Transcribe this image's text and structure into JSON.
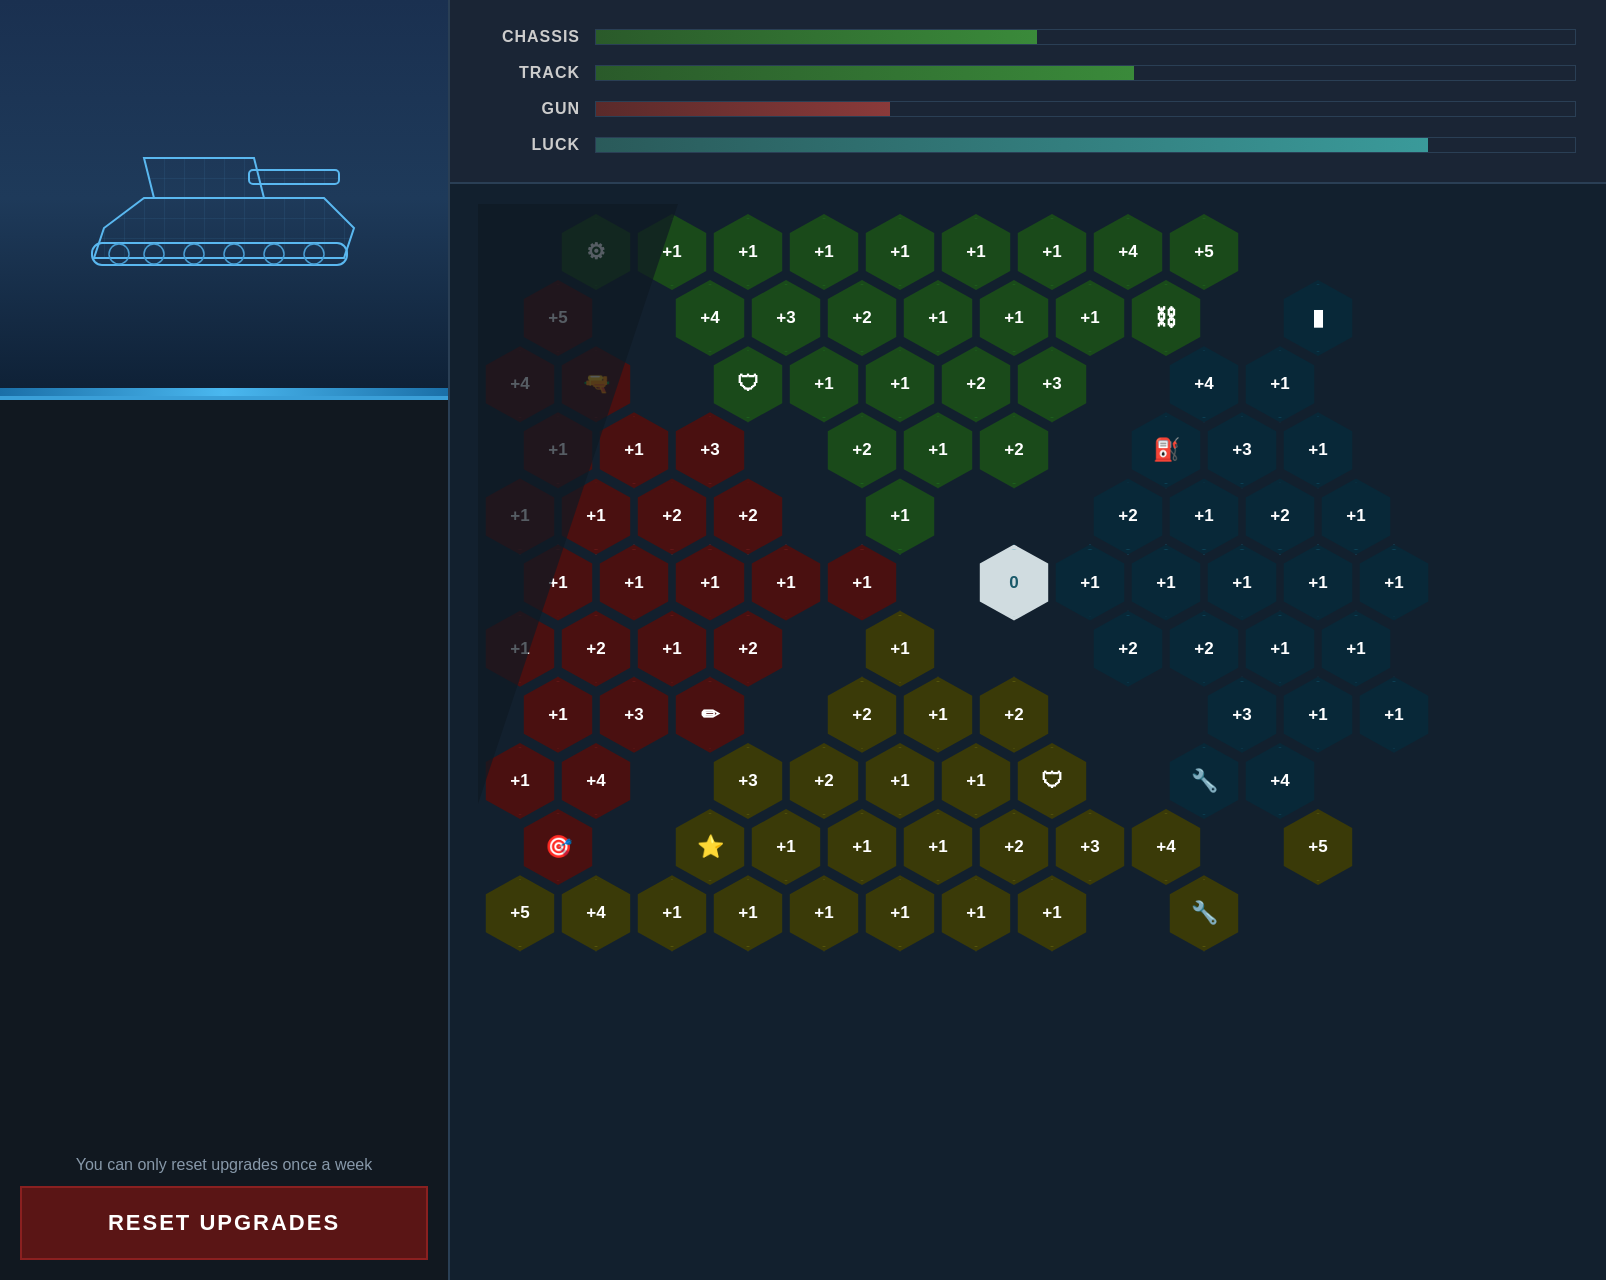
{
  "leftPanel": {
    "tankAlt": "Tank silhouette",
    "resetNotice": "You can only reset upgrades once a week",
    "resetButton": "RESET UPGRADES"
  },
  "stats": [
    {
      "label": "CHASSIS",
      "fillClass": "chassis-fill",
      "width": "45%"
    },
    {
      "label": "TRACK",
      "fillClass": "track-fill",
      "width": "55%"
    },
    {
      "label": "GUN",
      "fillClass": "gun-fill",
      "width": "30%"
    },
    {
      "label": "LUCK",
      "fillClass": "luck-fill",
      "width": "85%"
    }
  ],
  "colors": {
    "green": "#2a8a2a",
    "red": "#8a2a2a",
    "yellow": "#8a8a1a",
    "teal": "#1a6a8a",
    "center": "#3a8a9a"
  },
  "hexGrid": {
    "centerLabel": "0",
    "cells": [
      {
        "row": 0,
        "col": 0,
        "type": "green",
        "icon": "⚙",
        "label": ""
      },
      {
        "row": 0,
        "col": 1,
        "type": "green",
        "icon": "",
        "label": "+1"
      },
      {
        "row": 0,
        "col": 2,
        "type": "green",
        "icon": "",
        "label": "+1"
      },
      {
        "row": 0,
        "col": 3,
        "type": "green",
        "icon": "",
        "label": "+1"
      },
      {
        "row": 0,
        "col": 4,
        "type": "green",
        "icon": "",
        "label": "+1"
      },
      {
        "row": 0,
        "col": 5,
        "type": "green",
        "icon": "",
        "label": "+1"
      },
      {
        "row": 0,
        "col": 6,
        "type": "green",
        "icon": "",
        "label": "+1"
      },
      {
        "row": 0,
        "col": 7,
        "type": "green",
        "icon": "",
        "label": "+4"
      },
      {
        "row": 0,
        "col": 8,
        "type": "green",
        "icon": "",
        "label": "+5"
      },
      {
        "row": 1,
        "col": -1,
        "type": "red",
        "icon": "",
        "label": "+5"
      },
      {
        "row": 1,
        "col": 1,
        "type": "green",
        "icon": "",
        "label": "+4"
      },
      {
        "row": 1,
        "col": 2,
        "type": "green",
        "icon": "",
        "label": "+3"
      },
      {
        "row": 1,
        "col": 3,
        "type": "green",
        "icon": "",
        "label": "+2"
      },
      {
        "row": 1,
        "col": 4,
        "type": "green",
        "icon": "",
        "label": "+1"
      },
      {
        "row": 1,
        "col": 5,
        "type": "green",
        "icon": "",
        "label": "+1"
      },
      {
        "row": 1,
        "col": 6,
        "type": "green",
        "icon": "",
        "label": "+1"
      },
      {
        "row": 1,
        "col": 7,
        "type": "green",
        "icon": "⛓",
        "label": ""
      },
      {
        "row": 1,
        "col": 9,
        "type": "teal",
        "icon": "▮",
        "label": ""
      },
      {
        "row": 2,
        "col": -1,
        "type": "red",
        "icon": "",
        "label": "+4"
      },
      {
        "row": 2,
        "col": 0,
        "type": "red",
        "icon": "🔫",
        "label": ""
      },
      {
        "row": 2,
        "col": 2,
        "type": "green",
        "icon": "🛡",
        "label": ""
      },
      {
        "row": 2,
        "col": 3,
        "type": "green",
        "icon": "",
        "label": "+1"
      },
      {
        "row": 2,
        "col": 4,
        "type": "green",
        "icon": "",
        "label": "+1"
      },
      {
        "row": 2,
        "col": 5,
        "type": "green",
        "icon": "",
        "label": "+2"
      },
      {
        "row": 2,
        "col": 6,
        "type": "green",
        "icon": "",
        "label": "+3"
      },
      {
        "row": 2,
        "col": 8,
        "type": "teal",
        "icon": "",
        "label": "+4"
      },
      {
        "row": 2,
        "col": 9,
        "type": "teal",
        "icon": "",
        "label": "+1"
      },
      {
        "row": 3,
        "col": -1,
        "type": "red",
        "icon": "",
        "label": "+1"
      },
      {
        "row": 3,
        "col": 0,
        "type": "red",
        "icon": "",
        "label": "+1"
      },
      {
        "row": 3,
        "col": 1,
        "type": "red",
        "icon": "",
        "label": "+3"
      },
      {
        "row": 3,
        "col": 3,
        "type": "green",
        "icon": "",
        "label": "+2"
      },
      {
        "row": 3,
        "col": 4,
        "type": "green",
        "icon": "",
        "label": "+1"
      },
      {
        "row": 3,
        "col": 5,
        "type": "green",
        "icon": "",
        "label": "+2"
      },
      {
        "row": 3,
        "col": 7,
        "type": "teal",
        "icon": "⛽",
        "label": ""
      },
      {
        "row": 3,
        "col": 8,
        "type": "teal",
        "icon": "",
        "label": "+3"
      },
      {
        "row": 3,
        "col": 9,
        "type": "teal",
        "icon": "",
        "label": "+1"
      },
      {
        "row": 4,
        "col": -1,
        "type": "red",
        "icon": "",
        "label": "+1"
      },
      {
        "row": 4,
        "col": 0,
        "type": "red",
        "icon": "",
        "label": "+1"
      },
      {
        "row": 4,
        "col": 1,
        "type": "red",
        "icon": "",
        "label": "+2"
      },
      {
        "row": 4,
        "col": 2,
        "type": "red",
        "icon": "",
        "label": "+2"
      },
      {
        "row": 4,
        "col": 4,
        "type": "green",
        "icon": "",
        "label": "+1"
      },
      {
        "row": 4,
        "col": 7,
        "type": "teal",
        "icon": "",
        "label": "+2"
      },
      {
        "row": 4,
        "col": 8,
        "type": "teal",
        "icon": "",
        "label": "+1"
      },
      {
        "row": 4,
        "col": 9,
        "type": "teal",
        "icon": "",
        "label": "+2"
      },
      {
        "row": 4,
        "col": 10,
        "type": "teal",
        "icon": "",
        "label": "+1"
      },
      {
        "row": 5,
        "col": -1,
        "type": "red",
        "icon": "",
        "label": "+1"
      },
      {
        "row": 5,
        "col": 0,
        "type": "red",
        "icon": "",
        "label": "+1"
      },
      {
        "row": 5,
        "col": 1,
        "type": "red",
        "icon": "",
        "label": "+1"
      },
      {
        "row": 5,
        "col": 2,
        "type": "red",
        "icon": "",
        "label": "+1"
      },
      {
        "row": 5,
        "col": 3,
        "type": "red",
        "icon": "",
        "label": "+1"
      },
      {
        "row": 5,
        "col": 5,
        "type": "center",
        "icon": "",
        "label": "0"
      },
      {
        "row": 5,
        "col": 6,
        "type": "teal",
        "icon": "",
        "label": "+1"
      },
      {
        "row": 5,
        "col": 7,
        "type": "teal",
        "icon": "",
        "label": "+1"
      },
      {
        "row": 5,
        "col": 8,
        "type": "teal",
        "icon": "",
        "label": "+1"
      },
      {
        "row": 5,
        "col": 9,
        "type": "teal",
        "icon": "",
        "label": "+1"
      },
      {
        "row": 5,
        "col": 10,
        "type": "teal",
        "icon": "",
        "label": "+1"
      },
      {
        "row": 6,
        "col": -1,
        "type": "red",
        "icon": "",
        "label": "+1"
      },
      {
        "row": 6,
        "col": 0,
        "type": "red",
        "icon": "",
        "label": "+2"
      },
      {
        "row": 6,
        "col": 1,
        "type": "red",
        "icon": "",
        "label": "+1"
      },
      {
        "row": 6,
        "col": 2,
        "type": "red",
        "icon": "",
        "label": "+2"
      },
      {
        "row": 6,
        "col": 4,
        "type": "yellow",
        "icon": "",
        "label": "+1"
      },
      {
        "row": 6,
        "col": 7,
        "type": "teal",
        "icon": "",
        "label": "+2"
      },
      {
        "row": 6,
        "col": 8,
        "type": "teal",
        "icon": "",
        "label": "+2"
      },
      {
        "row": 6,
        "col": 9,
        "type": "teal",
        "icon": "",
        "label": "+1"
      },
      {
        "row": 6,
        "col": 10,
        "type": "teal",
        "icon": "",
        "label": "+1"
      },
      {
        "row": 7,
        "col": -1,
        "type": "red",
        "icon": "",
        "label": "+1"
      },
      {
        "row": 7,
        "col": 0,
        "type": "red",
        "icon": "",
        "label": "+3"
      },
      {
        "row": 7,
        "col": 1,
        "type": "red",
        "icon": "✏",
        "label": ""
      },
      {
        "row": 7,
        "col": 3,
        "type": "yellow",
        "icon": "",
        "label": "+2"
      },
      {
        "row": 7,
        "col": 4,
        "type": "yellow",
        "icon": "",
        "label": "+1"
      },
      {
        "row": 7,
        "col": 5,
        "type": "yellow",
        "icon": "",
        "label": "+2"
      },
      {
        "row": 7,
        "col": 8,
        "type": "teal",
        "icon": "",
        "label": "+3"
      },
      {
        "row": 7,
        "col": 9,
        "type": "teal",
        "icon": "",
        "label": "+1"
      },
      {
        "row": 7,
        "col": 10,
        "type": "teal",
        "icon": "",
        "label": "+1"
      },
      {
        "row": 8,
        "col": -1,
        "type": "red",
        "icon": "",
        "label": "+1"
      },
      {
        "row": 8,
        "col": 0,
        "type": "red",
        "icon": "",
        "label": "+4"
      },
      {
        "row": 8,
        "col": 2,
        "type": "yellow",
        "icon": "",
        "label": "+3"
      },
      {
        "row": 8,
        "col": 3,
        "type": "yellow",
        "icon": "",
        "label": "+2"
      },
      {
        "row": 8,
        "col": 4,
        "type": "yellow",
        "icon": "",
        "label": "+1"
      },
      {
        "row": 8,
        "col": 5,
        "type": "yellow",
        "icon": "",
        "label": "+1"
      },
      {
        "row": 8,
        "col": 6,
        "type": "yellow",
        "icon": "🛡",
        "label": ""
      },
      {
        "row": 8,
        "col": 8,
        "type": "teal",
        "icon": "🔧",
        "label": ""
      },
      {
        "row": 8,
        "col": 9,
        "type": "teal",
        "icon": "",
        "label": "+4"
      },
      {
        "row": 9,
        "col": -1,
        "type": "red",
        "icon": "🎯",
        "label": ""
      },
      {
        "row": 9,
        "col": 1,
        "type": "yellow",
        "icon": "⭐",
        "label": ""
      },
      {
        "row": 9,
        "col": 2,
        "type": "yellow",
        "icon": "",
        "label": "+1"
      },
      {
        "row": 9,
        "col": 3,
        "type": "yellow",
        "icon": "",
        "label": "+1"
      },
      {
        "row": 9,
        "col": 4,
        "type": "yellow",
        "icon": "",
        "label": "+1"
      },
      {
        "row": 9,
        "col": 5,
        "type": "yellow",
        "icon": "",
        "label": "+2"
      },
      {
        "row": 9,
        "col": 6,
        "type": "yellow",
        "icon": "",
        "label": "+3"
      },
      {
        "row": 9,
        "col": 7,
        "type": "yellow",
        "icon": "",
        "label": "+4"
      },
      {
        "row": 9,
        "col": 9,
        "type": "yellow",
        "icon": "",
        "label": "+5"
      },
      {
        "row": 10,
        "col": -1,
        "type": "yellow",
        "icon": "",
        "label": "+5"
      },
      {
        "row": 10,
        "col": 0,
        "type": "yellow",
        "icon": "",
        "label": "+4"
      },
      {
        "row": 10,
        "col": 1,
        "type": "yellow",
        "icon": "",
        "label": "+1"
      },
      {
        "row": 10,
        "col": 2,
        "type": "yellow",
        "icon": "",
        "label": "+1"
      },
      {
        "row": 10,
        "col": 3,
        "type": "yellow",
        "icon": "",
        "label": "+1"
      },
      {
        "row": 10,
        "col": 4,
        "type": "yellow",
        "icon": "",
        "label": "+1"
      },
      {
        "row": 10,
        "col": 5,
        "type": "yellow",
        "icon": "",
        "label": "+1"
      },
      {
        "row": 10,
        "col": 6,
        "type": "yellow",
        "icon": "",
        "label": "+1"
      },
      {
        "row": 10,
        "col": 8,
        "type": "yellow",
        "icon": "🔧",
        "label": ""
      }
    ]
  }
}
